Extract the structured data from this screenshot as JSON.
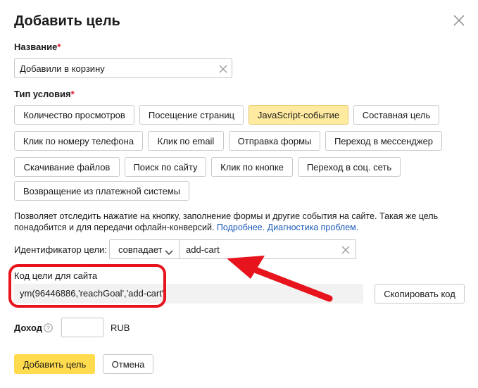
{
  "dialog": {
    "title": "Добавить цель",
    "close_icon": "close-icon"
  },
  "name_field": {
    "label": "Название",
    "required_mark": "*",
    "value": "Добавили в корзину"
  },
  "condition": {
    "label": "Тип условия",
    "required_mark": "*",
    "types": [
      "Количество просмотров",
      "Посещение страниц",
      "JavaScript-событие",
      "Составная цель",
      "Клик по номеру телефона",
      "Клик по email",
      "Отправка формы",
      "Переход в мессенджер",
      "Скачивание файлов",
      "Поиск по сайту",
      "Клик по кнопке",
      "Переход в соц. сеть",
      "Возвращение из платежной системы"
    ],
    "selected": "JavaScript-событие"
  },
  "description": {
    "text": "Позволяет отследить нажатие на кнопку, заполнение формы и другие события на сайте. Такая же цель понадобится и для передачи офлайн-конверсий.",
    "link_more": "Подробнее.",
    "link_diagnostics": "Диагностика проблем."
  },
  "goal_id": {
    "label": "Идентификатор цели:",
    "match_value": "совпадает",
    "value": "add-cart"
  },
  "site_code": {
    "label": "Код цели для сайта",
    "code": "ym(96446886,'reachGoal','add-cart')",
    "copy_label": "Скопировать код"
  },
  "income": {
    "label": "Доход",
    "info_icon": "info-icon",
    "value": "",
    "currency": "RUB"
  },
  "actions": {
    "submit_label": "Добавить цель",
    "cancel_label": "Отмена"
  },
  "annotation": {
    "color": "#e8141d"
  },
  "colors": {
    "accent_yellow": "#ffdb4d",
    "selected_chip": "#ffeba0",
    "link": "#1a5ab8",
    "required": "#e0172a"
  }
}
